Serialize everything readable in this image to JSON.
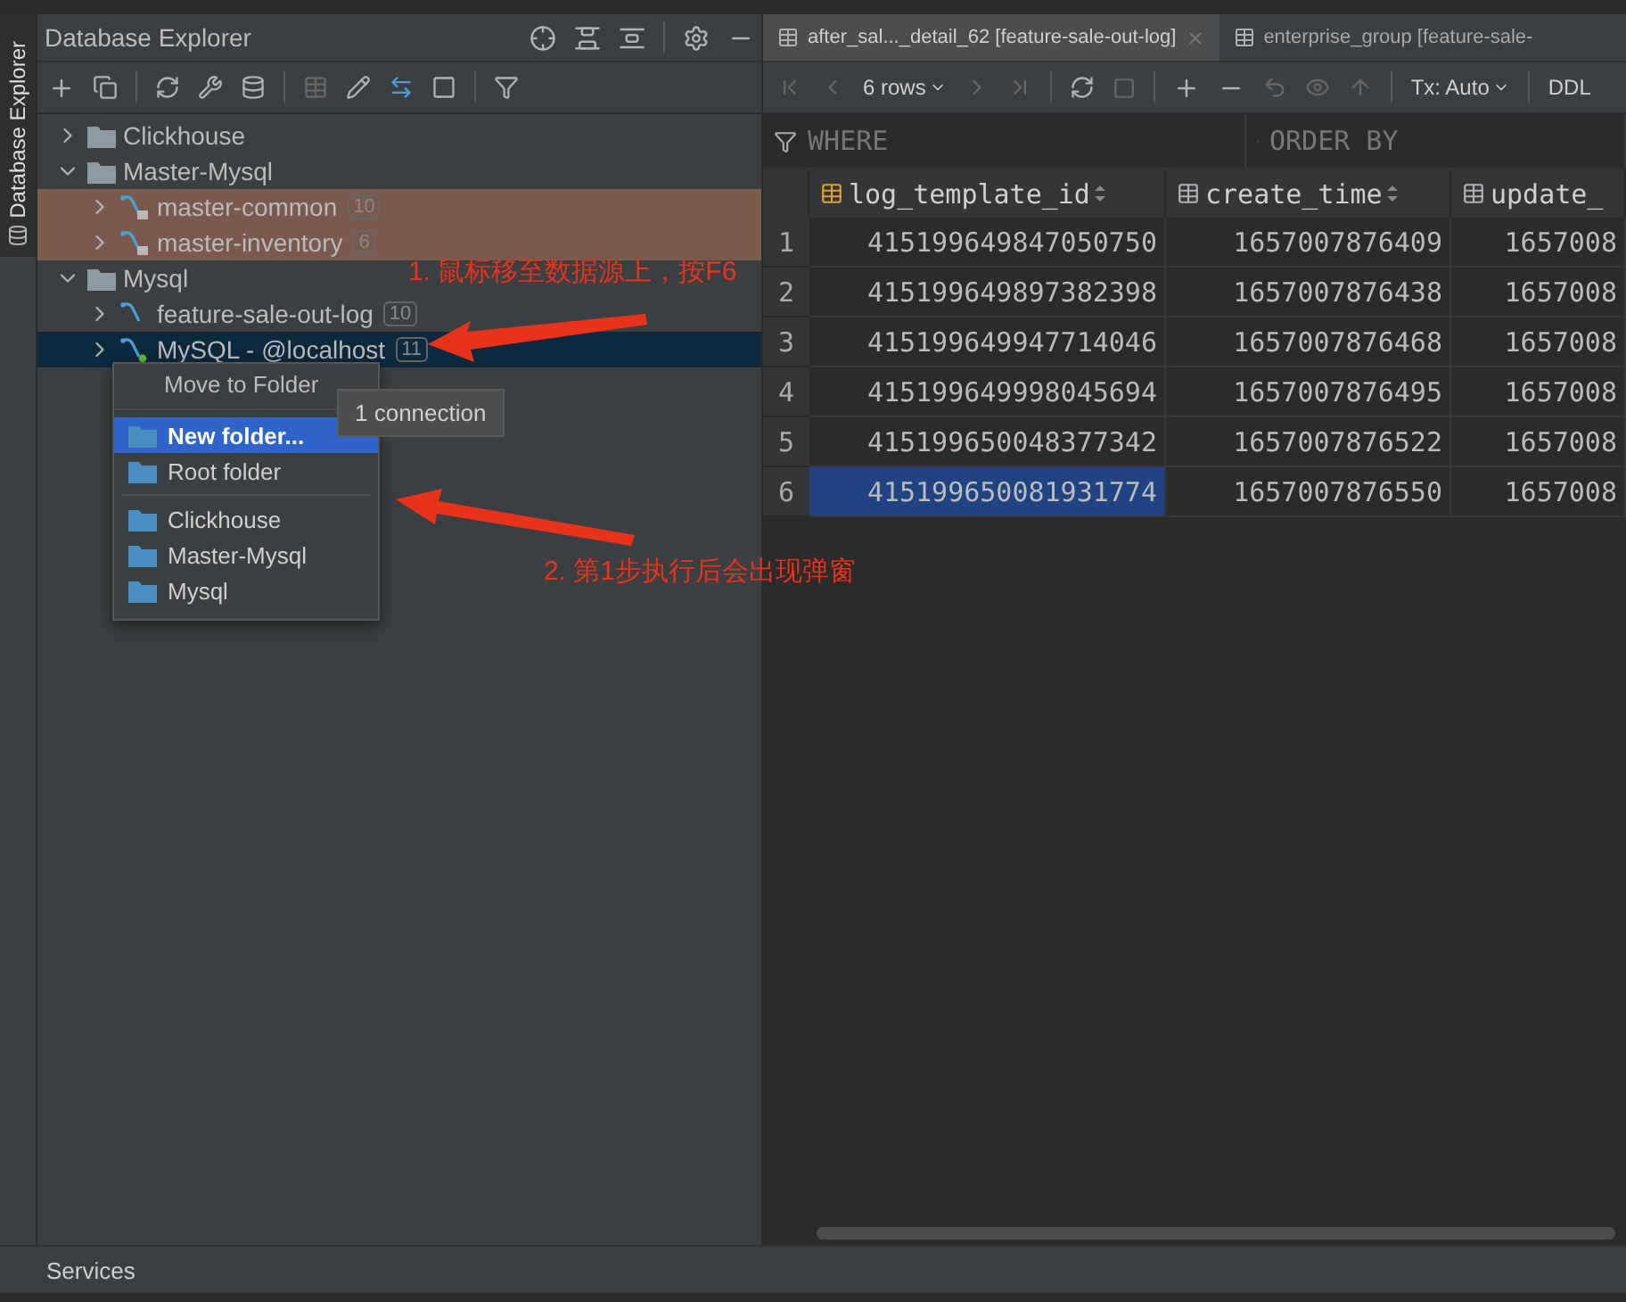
{
  "side_tab": {
    "label": "Database Explorer"
  },
  "explorer": {
    "title": "Database Explorer",
    "tree": [
      {
        "label": "Clickhouse",
        "kind": "folder",
        "expanded": false,
        "selected": false,
        "highlighted": false
      },
      {
        "label": "Master-Mysql",
        "kind": "folder",
        "expanded": true,
        "selected": false,
        "highlighted": false,
        "children": [
          {
            "label": "master-common",
            "kind": "datasource",
            "count": "10",
            "locked": true,
            "connected": false,
            "expanded": false,
            "selected": false,
            "highlighted": true
          },
          {
            "label": "master-inventory",
            "kind": "datasource",
            "count": "6",
            "locked": true,
            "connected": false,
            "expanded": false,
            "selected": false,
            "highlighted": true
          }
        ]
      },
      {
        "label": "Mysql",
        "kind": "folder",
        "expanded": true,
        "selected": false,
        "highlighted": false,
        "children": [
          {
            "label": "feature-sale-out-log",
            "kind": "datasource",
            "count": "10",
            "locked": false,
            "connected": false,
            "expanded": false,
            "selected": false,
            "highlighted": false
          },
          {
            "label": "MySQL - @localhost",
            "kind": "datasource",
            "count": "11",
            "locked": false,
            "connected": true,
            "expanded": false,
            "selected": true,
            "highlighted": false
          }
        ]
      }
    ]
  },
  "popup": {
    "title": "Move to Folder",
    "actions": [
      {
        "label": "New folder...",
        "selected": true
      },
      {
        "label": "Root folder",
        "selected": false
      }
    ],
    "folders": [
      {
        "label": "Clickhouse",
        "selected": false
      },
      {
        "label": "Master-Mysql",
        "selected": false
      },
      {
        "label": "Mysql",
        "selected": false
      }
    ]
  },
  "tooltip": {
    "text": "1 connection"
  },
  "annotations": [
    {
      "text": "1. 鼠标移至数据源上，按F6"
    },
    {
      "text": "2. 第1步执行后会出现弹窗"
    }
  ],
  "editor": {
    "tabs": [
      {
        "label": "after_sal..._detail_62 [feature-sale-out-log]",
        "selected": true
      },
      {
        "label": "enterprise_group [feature-sale-",
        "selected": false
      }
    ],
    "toolbar": {
      "rows": "6 rows",
      "tx": "Tx: Auto",
      "ddl": "DDL"
    },
    "filter": {
      "where": {
        "placeholder": "WHERE"
      },
      "order_by": {
        "placeholder": "ORDER BY"
      }
    },
    "columns": [
      {
        "label": "log_template_id",
        "kind": "key"
      },
      {
        "label": "create_time",
        "kind": "plain"
      },
      {
        "label": "update_",
        "kind": "plain"
      }
    ],
    "rows": [
      {
        "number": "1",
        "cells": [
          {
            "value": "415199649847050750",
            "selected": false
          },
          {
            "value": "1657007876409",
            "selected": false
          },
          {
            "value": "1657008",
            "selected": false
          }
        ]
      },
      {
        "number": "2",
        "cells": [
          {
            "value": "415199649897382398",
            "selected": false
          },
          {
            "value": "1657007876438",
            "selected": false
          },
          {
            "value": "1657008",
            "selected": false
          }
        ]
      },
      {
        "number": "3",
        "cells": [
          {
            "value": "415199649947714046",
            "selected": false
          },
          {
            "value": "1657007876468",
            "selected": false
          },
          {
            "value": "1657008",
            "selected": false
          }
        ]
      },
      {
        "number": "4",
        "cells": [
          {
            "value": "415199649998045694",
            "selected": false
          },
          {
            "value": "1657007876495",
            "selected": false
          },
          {
            "value": "1657008",
            "selected": false
          }
        ]
      },
      {
        "number": "5",
        "cells": [
          {
            "value": "415199650048377342",
            "selected": false
          },
          {
            "value": "1657007876522",
            "selected": false
          },
          {
            "value": "1657008",
            "selected": false
          }
        ]
      },
      {
        "number": "6",
        "cells": [
          {
            "value": "415199650081931774",
            "selected": true
          },
          {
            "value": "1657007876550",
            "selected": false
          },
          {
            "value": "1657008",
            "selected": false
          }
        ]
      }
    ]
  },
  "services": {
    "label": "Services"
  }
}
